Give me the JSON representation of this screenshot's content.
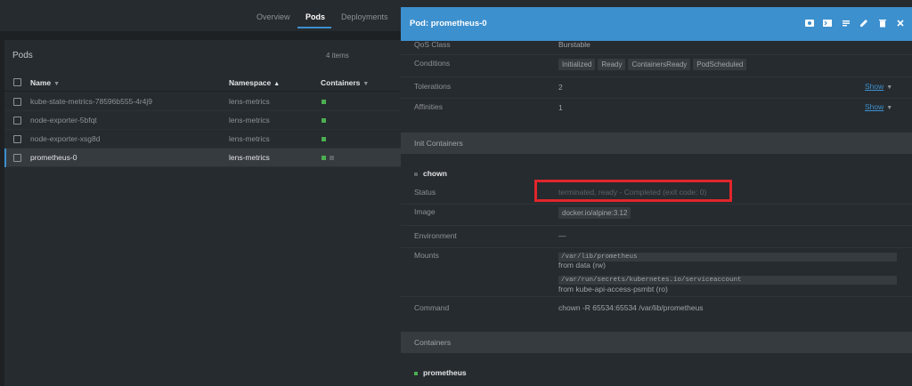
{
  "nav": {
    "tabs": [
      {
        "label": "Overview"
      },
      {
        "label": "Pods"
      },
      {
        "label": "Deployments"
      }
    ]
  },
  "list": {
    "title": "Pods",
    "count": "4 items",
    "columns": {
      "name": "Name",
      "namespace": "Namespace",
      "containers": "Containers"
    },
    "rows": [
      {
        "name": "kube-state-metrics-78596b555-4r4j9",
        "namespace": "lens-metrics",
        "selected": false
      },
      {
        "name": "node-exporter-5bfqt",
        "namespace": "lens-metrics",
        "selected": false
      },
      {
        "name": "node-exporter-xsg8d",
        "namespace": "lens-metrics",
        "selected": false
      },
      {
        "name": "prometheus-0",
        "namespace": "lens-metrics",
        "selected": true
      }
    ]
  },
  "details": {
    "title": "Pod: prometheus-0",
    "qos": {
      "label": "QoS Class",
      "value": "Burstable"
    },
    "conditions": {
      "label": "Conditions",
      "values": [
        "Initialized",
        "Ready",
        "ContainersReady",
        "PodScheduled"
      ]
    },
    "tolerations": {
      "label": "Tolerations",
      "value": "2",
      "show": "Show"
    },
    "affinities": {
      "label": "Affinities",
      "value": "1",
      "show": "Show"
    },
    "init_containers": {
      "section_title": "Init Containers",
      "container_name": "chown",
      "status_label": "Status",
      "status_value": "terminated, ready - Completed (exit code: 0)",
      "image_label": "Image",
      "image_value": "docker.io/alpine:3.12",
      "env_label": "Environment",
      "env_value": "—",
      "mounts_label": "Mounts",
      "mount1_path": "/var/lib/prometheus",
      "mount1_from": "from data (rw)",
      "mount2_path": "/var/run/secrets/kubernetes.io/serviceaccount",
      "mount2_from": "from kube-api-access-psmbt (ro)",
      "command_label": "Command",
      "command_value": "chown -R 65534:65534 /var/lib/prometheus"
    },
    "containers": {
      "section_title": "Containers",
      "container_name": "prometheus"
    }
  },
  "colors": {
    "accent": "#3d90ce",
    "ready_green": "#4caf50",
    "highlight_red": "#e0262b"
  }
}
